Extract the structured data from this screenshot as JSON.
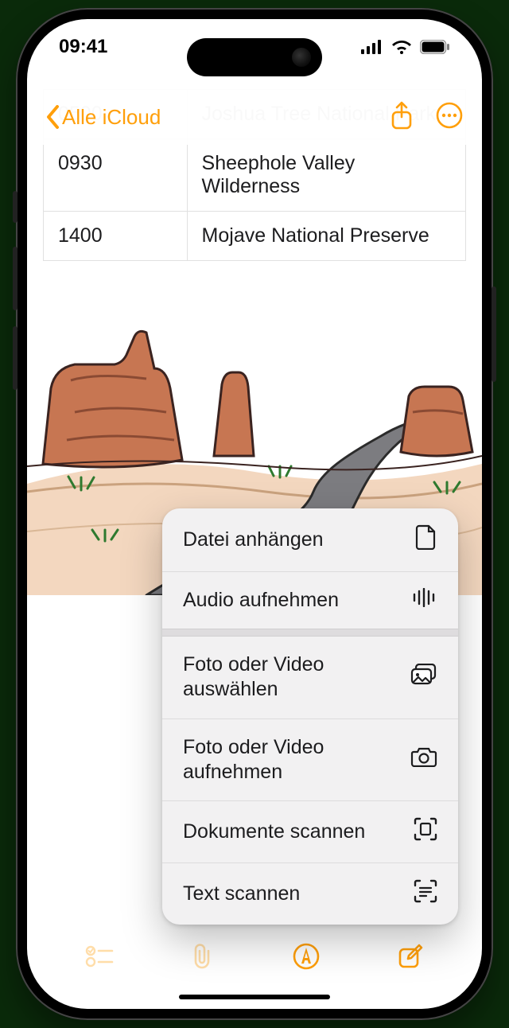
{
  "status": {
    "time": "09:41"
  },
  "nav": {
    "back_label": "Alle iCloud"
  },
  "table": {
    "rows": [
      {
        "time": "0500",
        "place": "Joshua Tree National Park",
        "faded": true
      },
      {
        "time": "0930",
        "place": "Sheephole Valley Wilderness",
        "faded": false
      },
      {
        "time": "1400",
        "place": "Mojave National Preserve",
        "faded": false
      }
    ]
  },
  "menu": {
    "items": [
      {
        "id": "attach-file",
        "label": "Datei anhängen",
        "icon": "document-icon"
      },
      {
        "id": "record-audio",
        "label": "Audio aufnehmen",
        "icon": "waveform-icon"
      },
      {
        "sep": true
      },
      {
        "id": "choose-media",
        "label": "Foto oder Video auswählen",
        "icon": "photo-library-icon"
      },
      {
        "id": "capture-media",
        "label": "Foto oder Video aufnehmen",
        "icon": "camera-icon"
      },
      {
        "id": "scan-docs",
        "label": "Dokumente scannen",
        "icon": "doc-scanner-icon"
      },
      {
        "id": "scan-text",
        "label": "Text scannen",
        "icon": "text-scanner-icon"
      }
    ]
  },
  "colors": {
    "accent": "#ff9f0a"
  }
}
